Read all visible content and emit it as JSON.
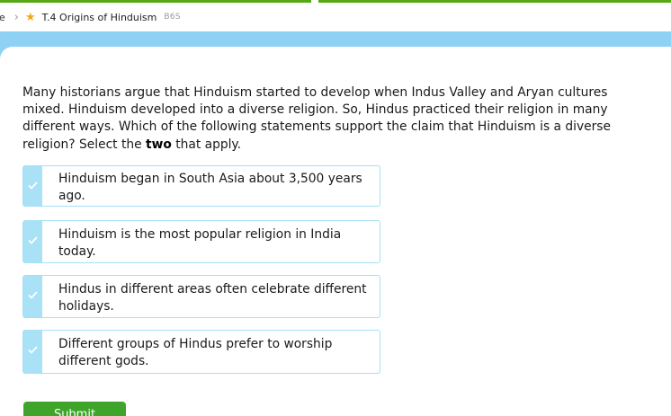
{
  "breadcrumb": {
    "previous": "e",
    "separator": "›",
    "star_icon": "star-icon",
    "title": "T.4 Origins of Hinduism",
    "code": "B6S"
  },
  "colors": {
    "progress": "#56a815",
    "blue_band": "#8fd1f4",
    "choice_border": "#a7e0f5",
    "check_box": "#a9e1f7",
    "submit": "#3ea52a",
    "star": "#f2a81d"
  },
  "question": {
    "text_before": "Many historians argue that Hinduism started to develop when Indus Valley and Aryan cultures mixed. Hinduism developed into a diverse religion. So, Hindus practiced their religion in many different ways. Which of the following statements support the claim that Hinduism is a diverse religion? Select the ",
    "emphasis": "two",
    "text_after": " that apply."
  },
  "choices": [
    {
      "label": "Hinduism began in South Asia about 3,500 years ago.",
      "checkmark": "checkmark-icon"
    },
    {
      "label": "Hinduism is the most popular religion in India today.",
      "checkmark": "checkmark-icon"
    },
    {
      "label": "Hindus in different areas often celebrate different holidays.",
      "checkmark": "checkmark-icon"
    },
    {
      "label": "Different groups of Hindus prefer to worship different gods.",
      "checkmark": "checkmark-icon"
    }
  ],
  "submit": {
    "label": "Submit"
  }
}
